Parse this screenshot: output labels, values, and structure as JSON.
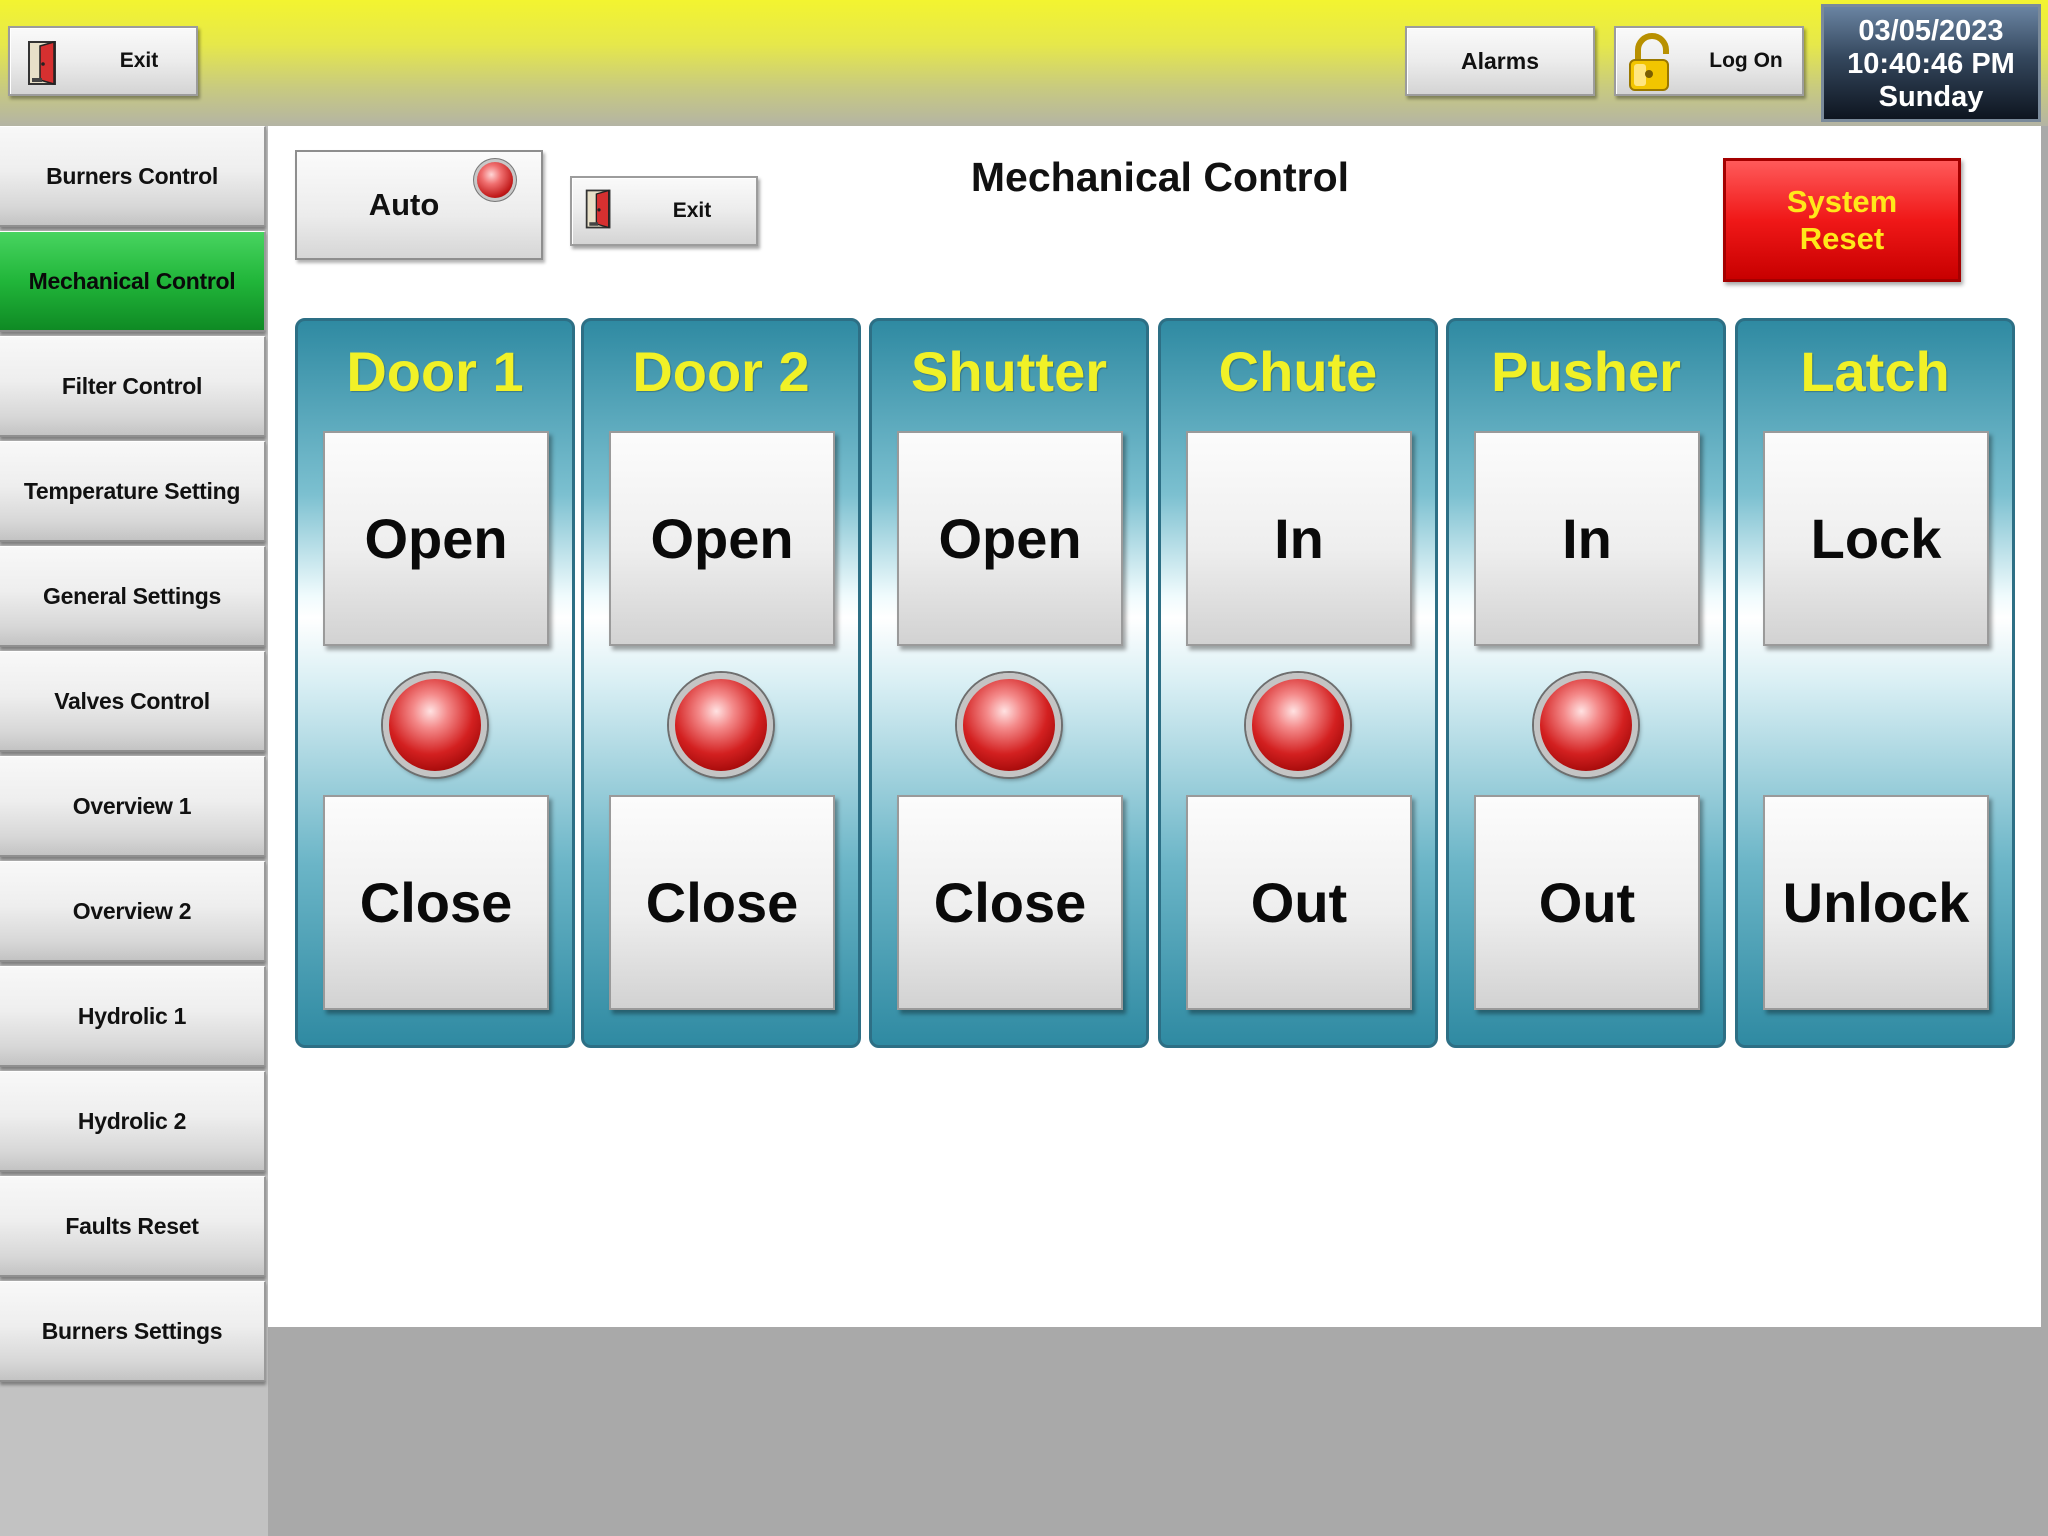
{
  "topbar": {
    "exit_label": "Exit",
    "alarms_label": "Alarms",
    "logon_label": "Log On",
    "date": "03/05/2023",
    "time": "10:40:46 PM",
    "day": "Sunday"
  },
  "sidebar": {
    "items": [
      {
        "label": "Burners Control"
      },
      {
        "label": "Mechanical Control",
        "active": true
      },
      {
        "label": "Filter Control"
      },
      {
        "label": "Temperature Setting"
      },
      {
        "label": "General Settings"
      },
      {
        "label": "Valves Control"
      },
      {
        "label": "Overview 1"
      },
      {
        "label": "Overview 2"
      },
      {
        "label": "Hydrolic 1"
      },
      {
        "label": "Hydrolic 2"
      },
      {
        "label": "Faults Reset"
      },
      {
        "label": "Burners Settings"
      }
    ]
  },
  "main": {
    "title": "Mechanical Control",
    "auto_label": "Auto",
    "exit_label": "Exit",
    "system_reset_line1": "System",
    "system_reset_line2": "Reset",
    "panels": [
      {
        "title": "Door 1",
        "top_label": "Open",
        "bottom_label": "Close",
        "has_lamp": true
      },
      {
        "title": "Door 2",
        "top_label": "Open",
        "bottom_label": "Close",
        "has_lamp": true
      },
      {
        "title": "Shutter",
        "top_label": "Open",
        "bottom_label": "Close",
        "has_lamp": true
      },
      {
        "title": "Chute",
        "top_label": "In",
        "bottom_label": "Out",
        "has_lamp": true
      },
      {
        "title": "Pusher",
        "top_label": "In",
        "bottom_label": "Out",
        "has_lamp": true
      },
      {
        "title": "Latch",
        "top_label": "Lock",
        "bottom_label": "Unlock",
        "has_lamp": false
      }
    ]
  },
  "colors": {
    "active_nav": "#21b63a",
    "panel_title": "#f1f127",
    "system_reset_bg": "#f01818",
    "system_reset_text": "#ffe81a",
    "lamp": "#d32020"
  },
  "icons": {
    "exit": "exit-door-icon",
    "logon": "padlock-icon"
  }
}
